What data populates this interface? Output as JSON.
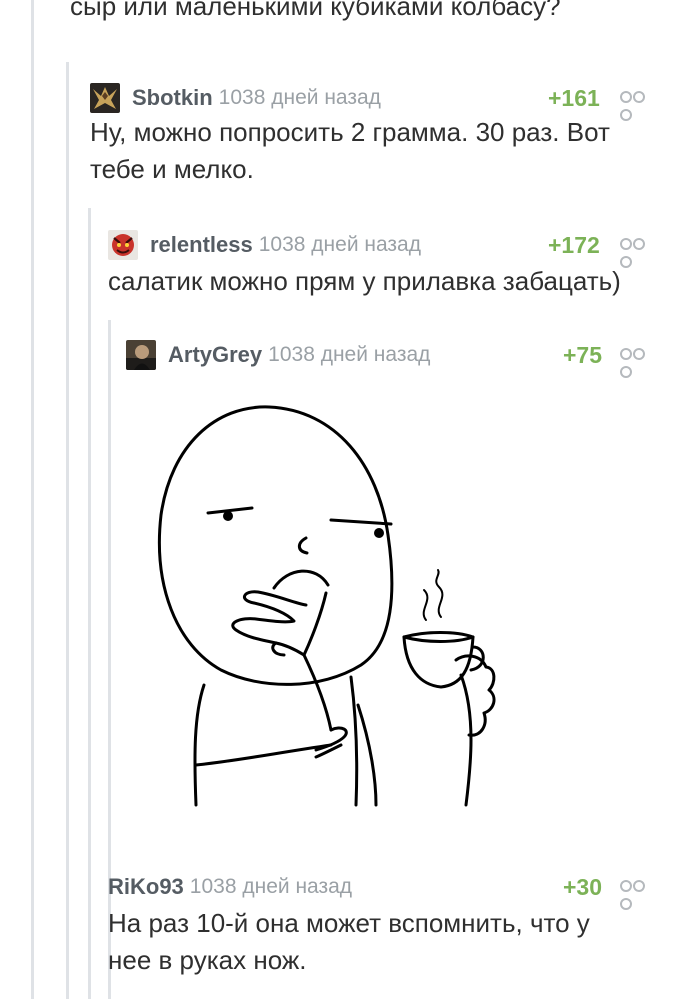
{
  "prev_comment": {
    "text_line1": "сыр или маленькими кубиками колбасу?"
  },
  "comments": [
    {
      "author": "Sbotkin",
      "time": "1038 дней назад",
      "rating": "+161",
      "text_line1": "Ну, можно попросить 2 грамма. 30 раз. Вот",
      "text_line2": "тебе и мелко."
    },
    {
      "author": "relentless",
      "time": "1038 дней назад",
      "rating": "+172",
      "text_line1": "салатик можно прям у прилавка забацать)"
    },
    {
      "author": "ArtyGrey",
      "time": "1038 дней назад",
      "rating": "+75",
      "image": "thinking-meme-with-coffee-cup"
    },
    {
      "author": "RiKo93",
      "time": "1038 дней назад",
      "rating": "+30",
      "text_line1": "На раз 10-й она может вспомнить, что у",
      "text_line2": "нее в руках нож."
    }
  ],
  "icons": {
    "more": "more-options-icon",
    "reply_line": "thread-line"
  },
  "colors": {
    "rating": "#7cb257",
    "author": "#555c63",
    "time": "#9aa0a5",
    "thread": "#dfe2e6"
  }
}
